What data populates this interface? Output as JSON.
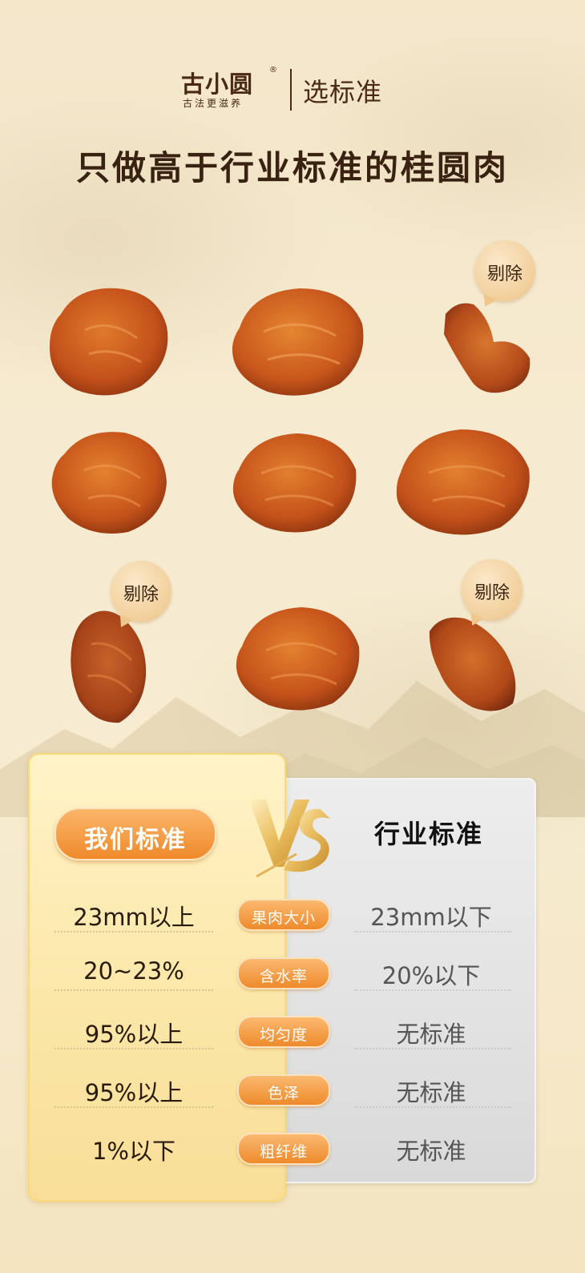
{
  "header": {
    "brand_name": "古小圆",
    "brand_reg": "®",
    "brand_slogan": "古法更滋养",
    "section_label": "选标准"
  },
  "title": "只做高于行业标准的桂圆肉",
  "remove_label": "剔除",
  "comparison": {
    "our_label": "我们标准",
    "vs_label": "VS",
    "industry_label": "行业标准",
    "rows": [
      {
        "criterion": "果肉大小",
        "ours": "23mm以上",
        "industry": "23mm以下"
      },
      {
        "criterion": "含水率",
        "ours": "20~23%",
        "industry": "20%以下"
      },
      {
        "criterion": "均匀度",
        "ours": "95%以上",
        "industry": "无标准"
      },
      {
        "criterion": "色泽",
        "ours": "95%以上",
        "industry": "无标准"
      },
      {
        "criterion": "粗纤维",
        "ours": "1%以下",
        "industry": "无标准"
      }
    ]
  },
  "colors": {
    "accent_orange": "#ef8a2b",
    "brand_brown": "#4a2a14",
    "longan_amber": "#c8551a"
  },
  "images": [
    "longan-piece-icon",
    "speech-bubble-icon",
    "vs-emblem-icon"
  ]
}
